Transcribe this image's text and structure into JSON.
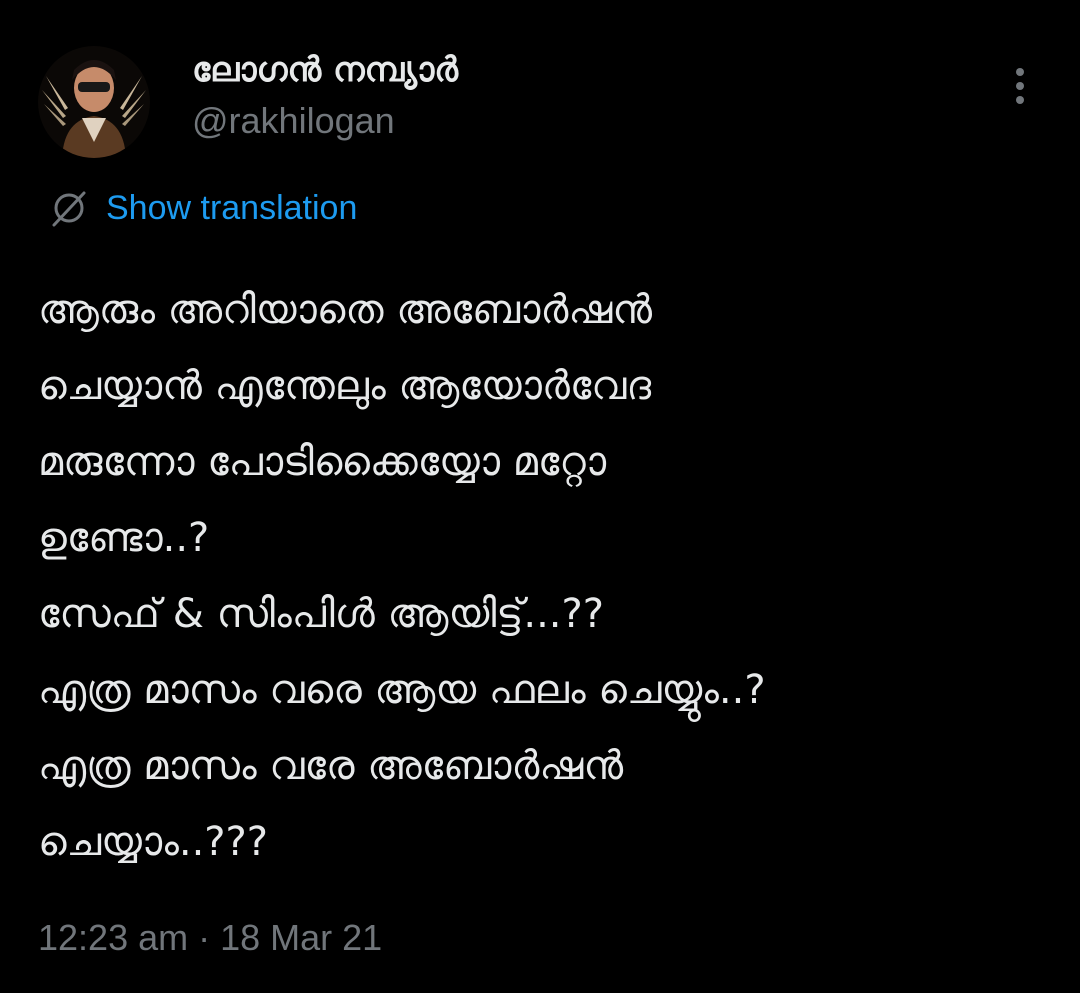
{
  "author": {
    "display_name": "ലോഗൻ നമ്പ്യാർ",
    "handle": "@rakhilogan",
    "avatar_icon": "profile-avatar"
  },
  "actions": {
    "more_icon": "more-vertical-icon"
  },
  "translation": {
    "icon": "globe-icon",
    "label": "Show translation",
    "color": "#1d9bf0"
  },
  "tweet": {
    "lines": [
      "ആരും അറിയാതെ അബോർഷൻ",
      "ചെയ്യാൻ എന്തേലും ആയോർവേദ",
      "മരുന്നോ പോടിക്കൈയ്യോ മറ്റോ",
      "ഉണ്ടോ..?",
      "സേഫ് & സിംപിൾ ആയിട്ട്...??",
      "എത്ര മാസം വരെ ആയ ഫലം ചെയ്യും..?",
      "എത്ര മാസം വരേ അബോർഷൻ",
      "ചെയ്യാം..???"
    ]
  },
  "meta": {
    "time": "12:23 am",
    "separator": "·",
    "date": "18 Mar 21"
  },
  "colors": {
    "background": "#000000",
    "primary_text": "#e7e9ea",
    "secondary_text": "#71767b",
    "link": "#1d9bf0"
  }
}
